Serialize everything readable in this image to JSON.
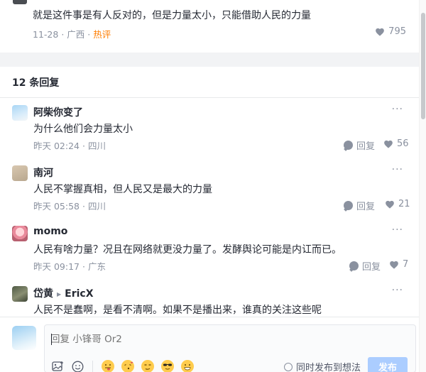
{
  "parent_comment": {
    "text": "就是这件事是有人反对的，但是力量太小，只能借助人民的力量",
    "date": "11-28",
    "location": "广西",
    "hot_badge": "热评",
    "likes": "795"
  },
  "replies_header": "12 条回复",
  "replies": [
    {
      "author": "阿柴你变了",
      "content": "为什么他们会力量太小",
      "time": "昨天 02:24",
      "location": "四川",
      "reply_label": "回复",
      "likes": "56"
    },
    {
      "author": "南河",
      "content": "人民不掌握真相，但人民又是最大的力量",
      "time": "昨天 05:58",
      "location": "四川",
      "reply_label": "回复",
      "likes": "21"
    },
    {
      "author": "momo",
      "content": "人民有啥力量？况且在网络就更没力量了。发酵舆论可能是内讧而已。",
      "time": "昨天 09:17",
      "location": "广东",
      "reply_label": "回复",
      "likes": "7"
    },
    {
      "author": "岱黄",
      "reply_to": "EricX",
      "content": "人民不是蠢啊，是看不清啊。如果不是播出来，谁真的关注这些呢"
    }
  ],
  "composer": {
    "placeholder": "回复 小锋哥 Or2",
    "sync_label": "同时发布到想法",
    "send_label": "发布"
  },
  "colors": {
    "hot": "#ff7d00",
    "send_button": "#abcdff",
    "meta_gray": "#8a919f"
  }
}
